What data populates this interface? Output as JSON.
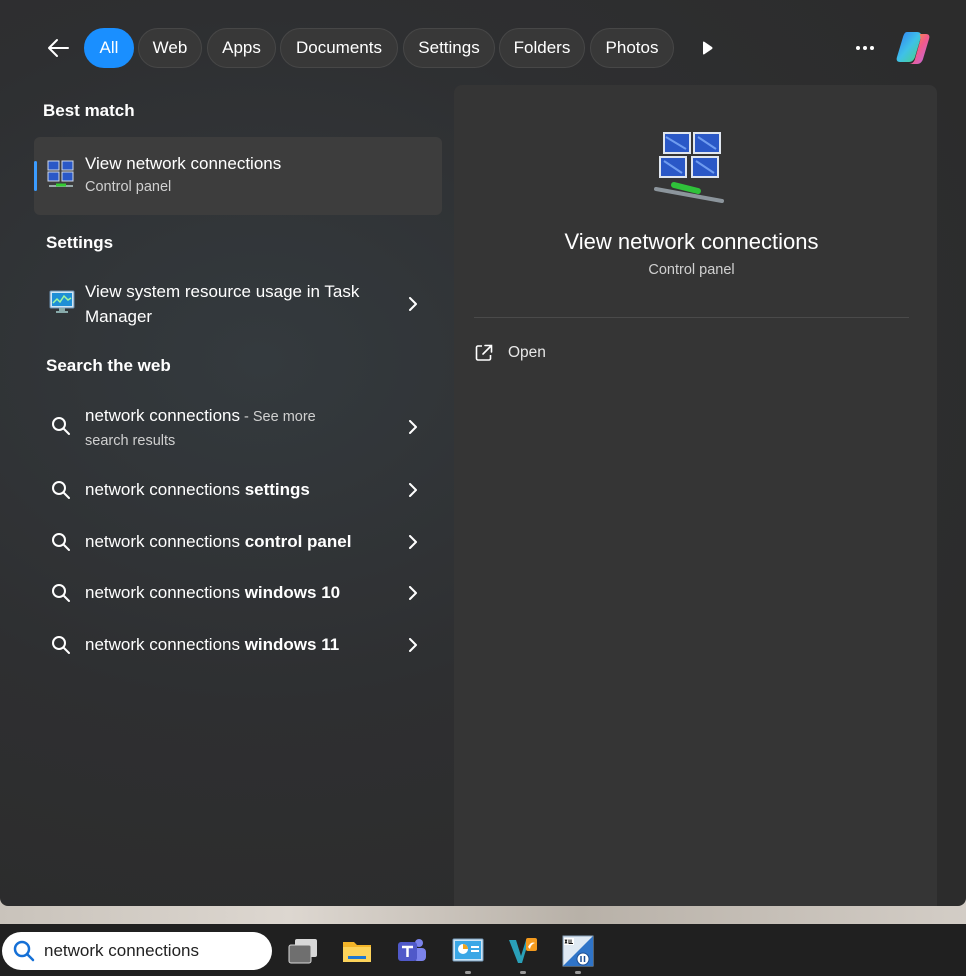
{
  "filters": {
    "back_label": "Back",
    "tabs": [
      "All",
      "Web",
      "Apps",
      "Documents",
      "Settings",
      "Folders",
      "Photos"
    ],
    "active_tab": "All",
    "more_label": "..."
  },
  "sections": {
    "best_match": "Best match",
    "settings": "Settings",
    "search_web": "Search the web"
  },
  "best_match": {
    "title": "View network connections",
    "subtitle": "Control panel",
    "icon": "network-connections-icon"
  },
  "settings_results": [
    {
      "line1": "View system resource usage in Task",
      "line2": "Manager",
      "icon": "task-manager-icon"
    }
  ],
  "web_results": [
    {
      "query": "network connections",
      "bold": "",
      "suffix": " - See more",
      "line2": "search results"
    },
    {
      "query": "network connections ",
      "bold": "settings"
    },
    {
      "query": "network connections ",
      "bold": "control panel"
    },
    {
      "query": "network connections ",
      "bold": "windows 10"
    },
    {
      "query": "network connections ",
      "bold": "windows 11"
    }
  ],
  "detail": {
    "title": "View network connections",
    "subtitle": "Control panel",
    "open_label": "Open"
  },
  "taskbar": {
    "search_value": "network connections",
    "apps": [
      "task-view-icon",
      "file-explorer-icon",
      "teams-icon",
      "control-panel-icon",
      "vs-app-icon",
      "x64-app-icon"
    ]
  },
  "colors": {
    "accent": "#1a8fff",
    "panel_bg": "#2c2c2c",
    "detail_bg": "#353535"
  }
}
